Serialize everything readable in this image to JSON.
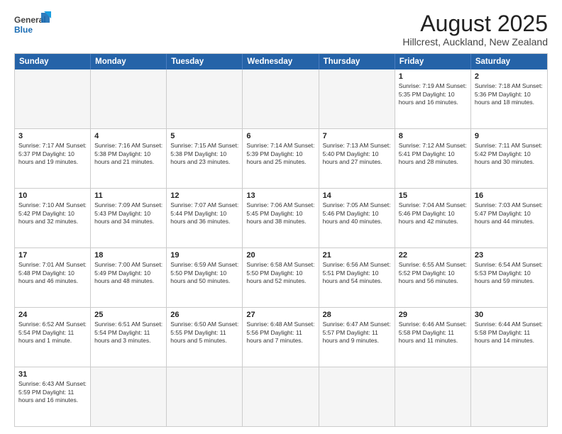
{
  "header": {
    "logo_general": "General",
    "logo_blue": "Blue",
    "title": "August 2025",
    "subtitle": "Hillcrest, Auckland, New Zealand"
  },
  "weekdays": [
    "Sunday",
    "Monday",
    "Tuesday",
    "Wednesday",
    "Thursday",
    "Friday",
    "Saturday"
  ],
  "weeks": [
    [
      {
        "day": "",
        "info": ""
      },
      {
        "day": "",
        "info": ""
      },
      {
        "day": "",
        "info": ""
      },
      {
        "day": "",
        "info": ""
      },
      {
        "day": "",
        "info": ""
      },
      {
        "day": "1",
        "info": "Sunrise: 7:19 AM\nSunset: 5:35 PM\nDaylight: 10 hours and 16 minutes."
      },
      {
        "day": "2",
        "info": "Sunrise: 7:18 AM\nSunset: 5:36 PM\nDaylight: 10 hours and 18 minutes."
      }
    ],
    [
      {
        "day": "3",
        "info": "Sunrise: 7:17 AM\nSunset: 5:37 PM\nDaylight: 10 hours and 19 minutes."
      },
      {
        "day": "4",
        "info": "Sunrise: 7:16 AM\nSunset: 5:38 PM\nDaylight: 10 hours and 21 minutes."
      },
      {
        "day": "5",
        "info": "Sunrise: 7:15 AM\nSunset: 5:38 PM\nDaylight: 10 hours and 23 minutes."
      },
      {
        "day": "6",
        "info": "Sunrise: 7:14 AM\nSunset: 5:39 PM\nDaylight: 10 hours and 25 minutes."
      },
      {
        "day": "7",
        "info": "Sunrise: 7:13 AM\nSunset: 5:40 PM\nDaylight: 10 hours and 27 minutes."
      },
      {
        "day": "8",
        "info": "Sunrise: 7:12 AM\nSunset: 5:41 PM\nDaylight: 10 hours and 28 minutes."
      },
      {
        "day": "9",
        "info": "Sunrise: 7:11 AM\nSunset: 5:42 PM\nDaylight: 10 hours and 30 minutes."
      }
    ],
    [
      {
        "day": "10",
        "info": "Sunrise: 7:10 AM\nSunset: 5:42 PM\nDaylight: 10 hours and 32 minutes."
      },
      {
        "day": "11",
        "info": "Sunrise: 7:09 AM\nSunset: 5:43 PM\nDaylight: 10 hours and 34 minutes."
      },
      {
        "day": "12",
        "info": "Sunrise: 7:07 AM\nSunset: 5:44 PM\nDaylight: 10 hours and 36 minutes."
      },
      {
        "day": "13",
        "info": "Sunrise: 7:06 AM\nSunset: 5:45 PM\nDaylight: 10 hours and 38 minutes."
      },
      {
        "day": "14",
        "info": "Sunrise: 7:05 AM\nSunset: 5:46 PM\nDaylight: 10 hours and 40 minutes."
      },
      {
        "day": "15",
        "info": "Sunrise: 7:04 AM\nSunset: 5:46 PM\nDaylight: 10 hours and 42 minutes."
      },
      {
        "day": "16",
        "info": "Sunrise: 7:03 AM\nSunset: 5:47 PM\nDaylight: 10 hours and 44 minutes."
      }
    ],
    [
      {
        "day": "17",
        "info": "Sunrise: 7:01 AM\nSunset: 5:48 PM\nDaylight: 10 hours and 46 minutes."
      },
      {
        "day": "18",
        "info": "Sunrise: 7:00 AM\nSunset: 5:49 PM\nDaylight: 10 hours and 48 minutes."
      },
      {
        "day": "19",
        "info": "Sunrise: 6:59 AM\nSunset: 5:50 PM\nDaylight: 10 hours and 50 minutes."
      },
      {
        "day": "20",
        "info": "Sunrise: 6:58 AM\nSunset: 5:50 PM\nDaylight: 10 hours and 52 minutes."
      },
      {
        "day": "21",
        "info": "Sunrise: 6:56 AM\nSunset: 5:51 PM\nDaylight: 10 hours and 54 minutes."
      },
      {
        "day": "22",
        "info": "Sunrise: 6:55 AM\nSunset: 5:52 PM\nDaylight: 10 hours and 56 minutes."
      },
      {
        "day": "23",
        "info": "Sunrise: 6:54 AM\nSunset: 5:53 PM\nDaylight: 10 hours and 59 minutes."
      }
    ],
    [
      {
        "day": "24",
        "info": "Sunrise: 6:52 AM\nSunset: 5:54 PM\nDaylight: 11 hours and 1 minute."
      },
      {
        "day": "25",
        "info": "Sunrise: 6:51 AM\nSunset: 5:54 PM\nDaylight: 11 hours and 3 minutes."
      },
      {
        "day": "26",
        "info": "Sunrise: 6:50 AM\nSunset: 5:55 PM\nDaylight: 11 hours and 5 minutes."
      },
      {
        "day": "27",
        "info": "Sunrise: 6:48 AM\nSunset: 5:56 PM\nDaylight: 11 hours and 7 minutes."
      },
      {
        "day": "28",
        "info": "Sunrise: 6:47 AM\nSunset: 5:57 PM\nDaylight: 11 hours and 9 minutes."
      },
      {
        "day": "29",
        "info": "Sunrise: 6:46 AM\nSunset: 5:58 PM\nDaylight: 11 hours and 11 minutes."
      },
      {
        "day": "30",
        "info": "Sunrise: 6:44 AM\nSunset: 5:58 PM\nDaylight: 11 hours and 14 minutes."
      }
    ],
    [
      {
        "day": "31",
        "info": "Sunrise: 6:43 AM\nSunset: 5:59 PM\nDaylight: 11 hours and 16 minutes."
      },
      {
        "day": "",
        "info": ""
      },
      {
        "day": "",
        "info": ""
      },
      {
        "day": "",
        "info": ""
      },
      {
        "day": "",
        "info": ""
      },
      {
        "day": "",
        "info": ""
      },
      {
        "day": "",
        "info": ""
      }
    ]
  ]
}
